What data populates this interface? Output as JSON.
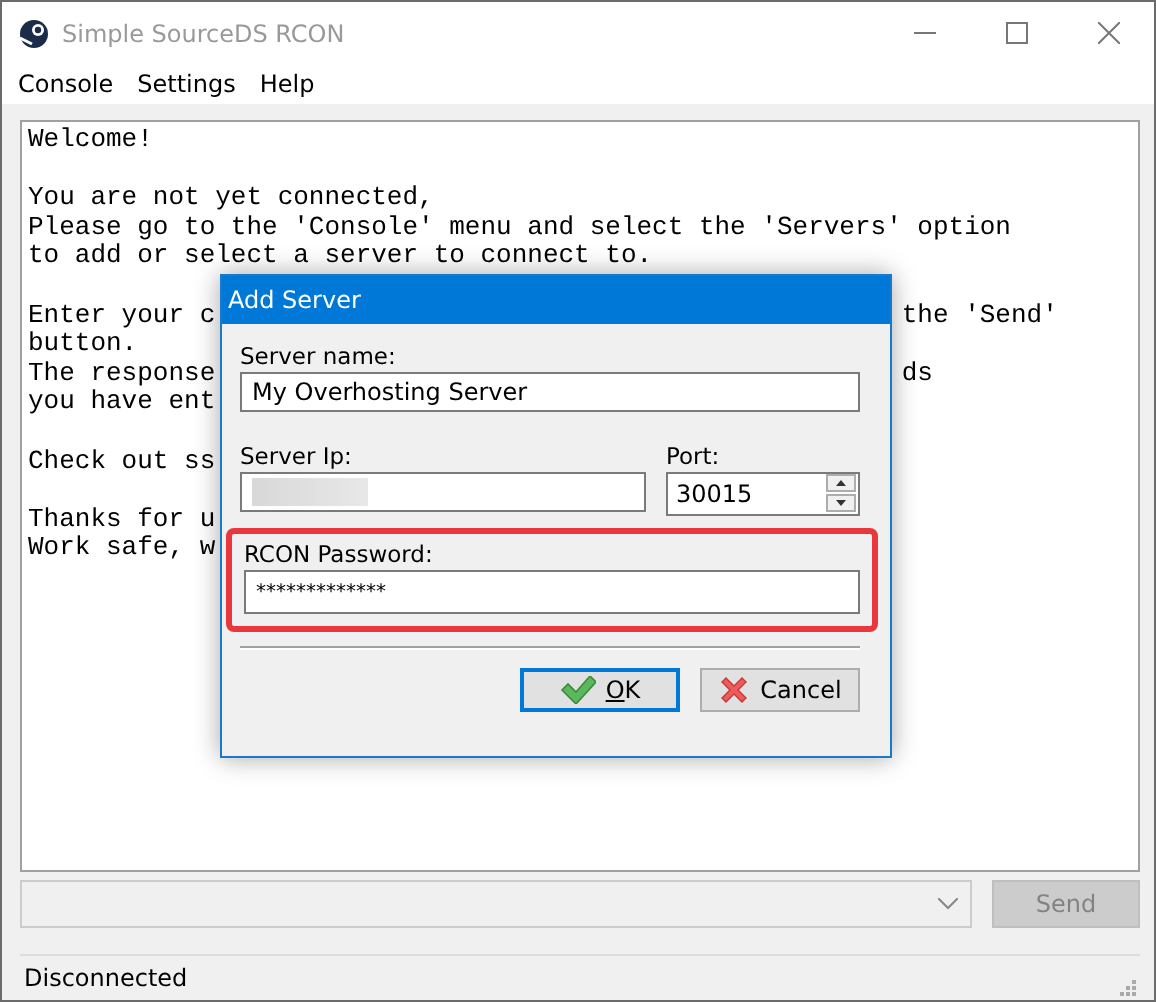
{
  "window": {
    "title": "Simple SourceDS RCON"
  },
  "menu": [
    "Console",
    "Settings",
    "Help"
  ],
  "console": {
    "paragraphs": [
      [
        {
          "left": "Welcome!"
        }
      ],
      [
        {
          "left": "You are not yet connected,"
        },
        {
          "left": "Please go to the 'Console' menu and select the 'Servers' option"
        },
        {
          "left": "to add or select a server to connect to."
        }
      ],
      [
        {
          "left": "Enter your c",
          "right": "the 'Send'"
        },
        {
          "left": "button."
        },
        {
          "left": "The response",
          "right": "ds"
        },
        {
          "left": "you have ent"
        }
      ],
      [
        {
          "left": "Check out ss"
        }
      ],
      [
        {
          "left": "Thanks for u"
        },
        {
          "left": "Work safe, w"
        }
      ]
    ]
  },
  "command": {
    "disabled": true
  },
  "send_button": {
    "label": "Send",
    "disabled": true
  },
  "status_bar": {
    "text": "Disconnected"
  },
  "dialog": {
    "title": "Add Server",
    "server_name": {
      "label": "Server name:",
      "value": "My Overhosting Server"
    },
    "server_ip": {
      "label": "Server Ip:",
      "redacted": true
    },
    "port": {
      "label": "Port:",
      "value": "30015"
    },
    "password": {
      "label": "RCON Password:",
      "value": "*************",
      "highlighted": true
    },
    "buttons": [
      {
        "kind": "ok",
        "label": "OK",
        "mnemonic": true,
        "selected": true
      },
      {
        "kind": "cancel",
        "label": "Cancel",
        "selected": false
      }
    ]
  }
}
